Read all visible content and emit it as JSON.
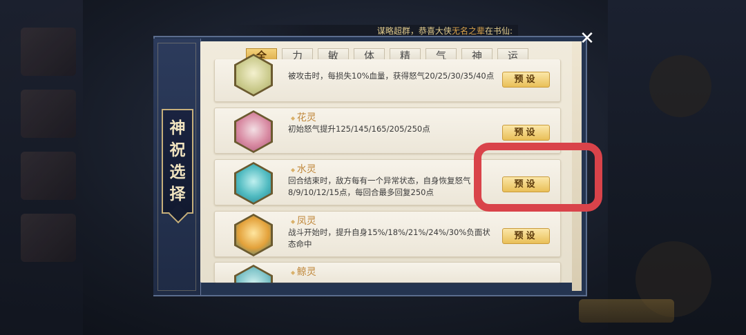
{
  "announcement": {
    "prefix": "谋略超群，恭喜大侠",
    "player": "无名之辈",
    "suffix": "在书仙:"
  },
  "dialog": {
    "title_chars": [
      "神",
      "祝",
      "选",
      "择"
    ],
    "close_label": "✕",
    "tabs": [
      "全",
      "力",
      "敏",
      "体",
      "精",
      "气",
      "神",
      "运"
    ],
    "active_tab": "全",
    "preset_label": "预设",
    "items": [
      {
        "name": "",
        "desc": "被攻击时，每损失10%血量，获得怒气20/25/30/35/40点",
        "portrait_color": "#d8d9a0"
      },
      {
        "name": "花灵",
        "desc": "初始怒气提升125/145/165/205/250点",
        "portrait_color": "#e7b9c4"
      },
      {
        "name": "水灵",
        "desc": "回合结束时，敌方每有一个异常状态，自身恢复怒气8/9/10/12/15点，每回合最多回复250点",
        "portrait_color": "#5ec7c9"
      },
      {
        "name": "凤灵",
        "desc": "战斗开始时，提升自身15%/18%/21%/24%/30%负面状态命中",
        "portrait_color": "#e2a93a"
      },
      {
        "name": "鲸灵",
        "desc": "",
        "portrait_color": "#7ec3c8"
      }
    ]
  },
  "colors": {
    "highlight": "#d9434a",
    "active_tab": "#e2b24f"
  }
}
